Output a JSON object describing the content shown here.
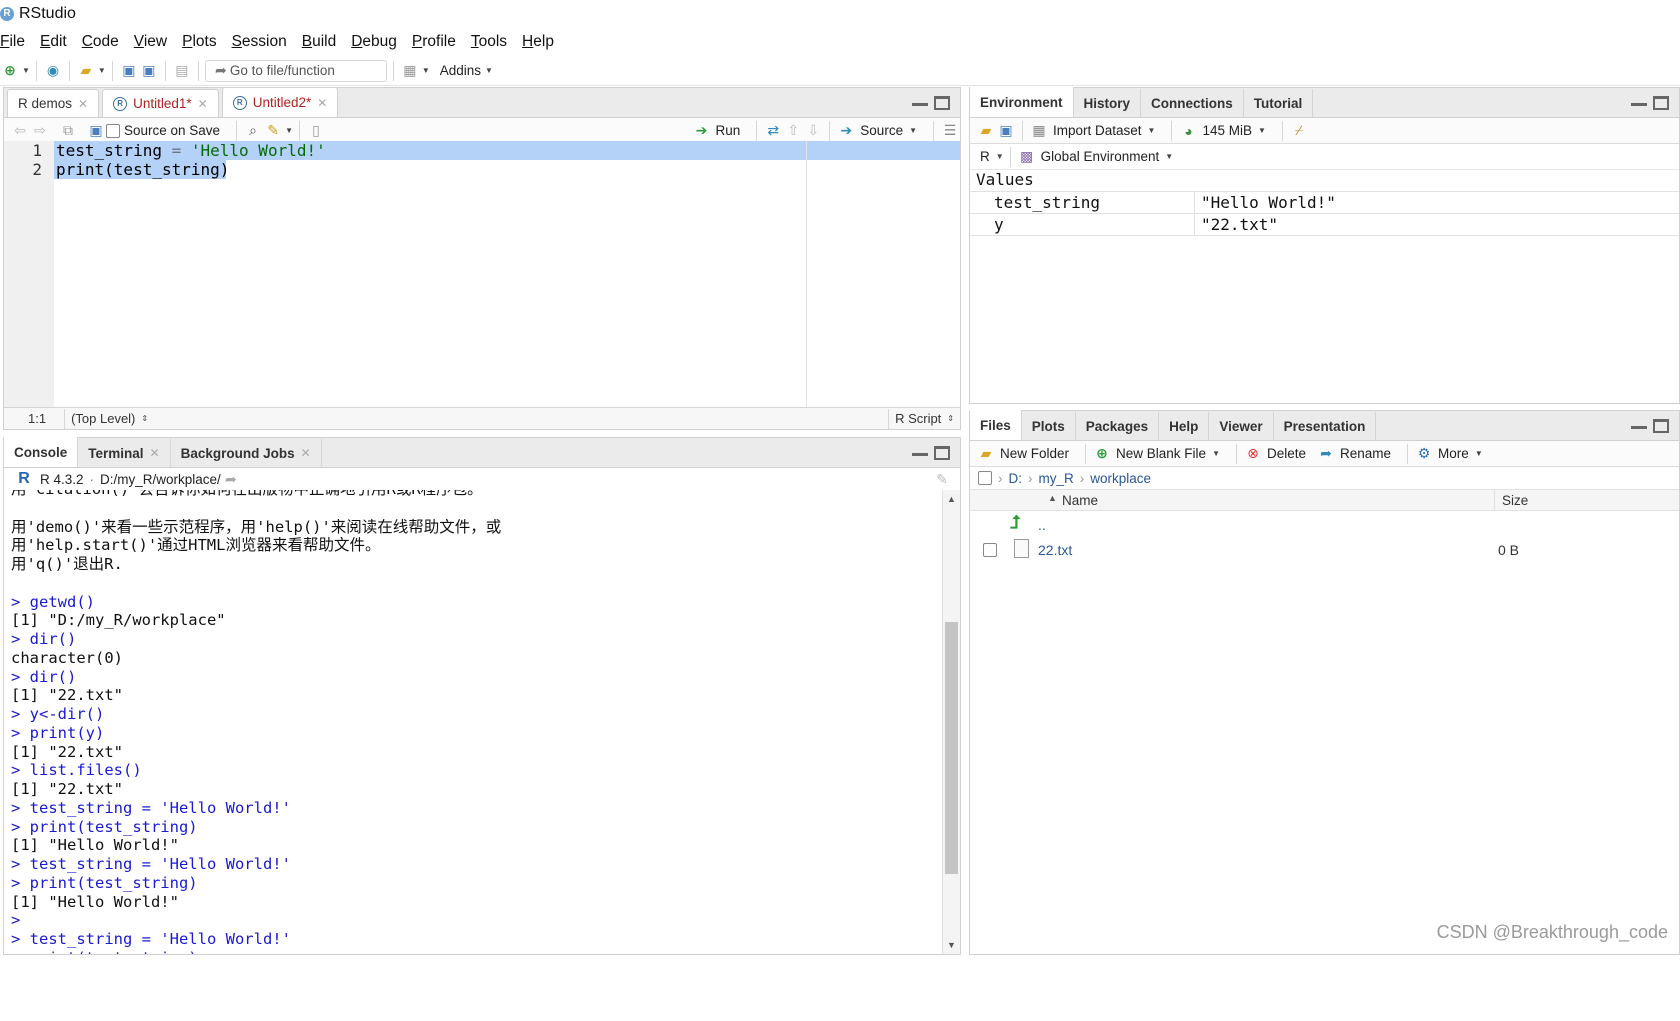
{
  "app": {
    "title": "RStudio",
    "logo_letter": "R"
  },
  "menu": [
    "File",
    "Edit",
    "Code",
    "View",
    "Plots",
    "Session",
    "Build",
    "Debug",
    "Profile",
    "Tools",
    "Help"
  ],
  "toolbar": {
    "goto_placeholder": "Go to file/function",
    "addins_label": "Addins"
  },
  "source": {
    "tabs": [
      {
        "label": "R demos",
        "modified": false
      },
      {
        "label": "Untitled1*",
        "modified": true
      },
      {
        "label": "Untitled2*",
        "modified": true
      }
    ],
    "source_on_save": "Source on Save",
    "run_label": "Run",
    "source_label": "Source",
    "lines": [
      {
        "num": "1",
        "a": "test_string",
        "b": " = ",
        "c": "'Hello World!'"
      },
      {
        "num": "2",
        "a": "print(test_string)",
        "b": "",
        "c": ""
      }
    ],
    "status": {
      "position": "1:1",
      "scope": "(Top Level)",
      "type": "R Script"
    }
  },
  "console": {
    "tabs": [
      "Console",
      "Terminal",
      "Background Jobs"
    ],
    "version": "R 4.3.2",
    "path": "D:/my_R/workplace/",
    "lines": [
      {
        "t": "用'citation()'会告诉你如何在出版物中正确地引用R或R程序包。",
        "cmd": false
      },
      {
        "t": "",
        "cmd": false
      },
      {
        "t": "用'demo()'来看一些示范程序，用'help()'来阅读在线帮助文件，或",
        "cmd": false
      },
      {
        "t": "用'help.start()'通过HTML浏览器来看帮助文件。",
        "cmd": false
      },
      {
        "t": "用'q()'退出R.",
        "cmd": false
      },
      {
        "t": "",
        "cmd": false
      },
      {
        "t": "> getwd()",
        "cmd": true
      },
      {
        "t": "[1] \"D:/my_R/workplace\"",
        "cmd": false
      },
      {
        "t": "> dir()",
        "cmd": true
      },
      {
        "t": "character(0)",
        "cmd": false
      },
      {
        "t": "> dir()",
        "cmd": true
      },
      {
        "t": "[1] \"22.txt\"",
        "cmd": false
      },
      {
        "t": "> y<-dir()",
        "cmd": true
      },
      {
        "t": "> print(y)",
        "cmd": true
      },
      {
        "t": "[1] \"22.txt\"",
        "cmd": false
      },
      {
        "t": "> list.files()",
        "cmd": true
      },
      {
        "t": "[1] \"22.txt\"",
        "cmd": false
      },
      {
        "t": "> test_string = 'Hello World!'",
        "cmd": true
      },
      {
        "t": "> print(test_string)",
        "cmd": true
      },
      {
        "t": "[1] \"Hello World!\"",
        "cmd": false
      },
      {
        "t": "> test_string = 'Hello World!'",
        "cmd": true
      },
      {
        "t": "> print(test_string)",
        "cmd": true
      },
      {
        "t": "[1] \"Hello World!\"",
        "cmd": false
      },
      {
        "t": ">",
        "cmd": true
      },
      {
        "t": "> test_string = 'Hello World!'",
        "cmd": true
      },
      {
        "t": "> print(test_string)",
        "cmd": true
      }
    ]
  },
  "environment": {
    "tabs": [
      "Environment",
      "History",
      "Connections",
      "Tutorial"
    ],
    "import_label": "Import Dataset",
    "memory": "145 MiB",
    "lang": "R",
    "scope": "Global Environment",
    "section": "Values",
    "values": [
      {
        "name": "test_string",
        "value": "\"Hello World!\""
      },
      {
        "name": "y",
        "value": "\"22.txt\""
      }
    ]
  },
  "files": {
    "tabs": [
      "Files",
      "Plots",
      "Packages",
      "Help",
      "Viewer",
      "Presentation"
    ],
    "new_folder": "New Folder",
    "new_blank_file": "New Blank File",
    "delete": "Delete",
    "rename": "Rename",
    "more": "More",
    "breadcrumb": [
      "D:",
      "my_R",
      "workplace"
    ],
    "col_name": "Name",
    "col_size": "Size",
    "parent": "..",
    "rows": [
      {
        "name": "22.txt",
        "size": "0 B"
      }
    ]
  },
  "watermark": "CSDN @Breakthrough_code",
  "colors": {
    "accent_blue": "#1a1ad1",
    "string_green": "#036a07",
    "selection": "#b4d1f7",
    "modified_red": "#b22222"
  }
}
